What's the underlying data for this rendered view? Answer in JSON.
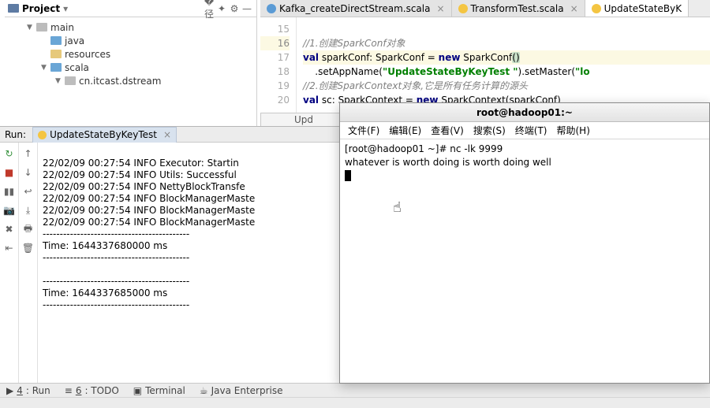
{
  "project": {
    "title": "Project",
    "tree": {
      "main": "main",
      "java": "java",
      "resources": "resources",
      "scala": "scala",
      "pkg": "cn.itcast.dstream"
    }
  },
  "tabs": {
    "t0": "Kafka_createDirectStream.scala",
    "t1": "TransformTest.scala",
    "t2": "UpdateStateByK"
  },
  "code": {
    "c1": "//1.创建SparkConf对象",
    "l2a": "val",
    "l2b": " sparkConf: SparkConf = ",
    "l2c": "new",
    "l2d": " SparkConf",
    "l2e": "()",
    "l3a": "    .setAppName(",
    "l3b": "\"UpdateStateByKeyTest \"",
    "l3c": ").setMaster(",
    "l3d": "\"lo",
    "c2": "//2.创建SparkContext对象,它是所有任务计算的源头",
    "l5a": "val",
    "l5b": " sc: SparkContext = ",
    "l5c": "new",
    "l5d": " SparkContext(sparkConf)",
    "gutter": {
      "n15": "15",
      "n16": "16",
      "n17": "17",
      "n18": "18",
      "n19": "19",
      "n20": "20"
    }
  },
  "breadcrumb": "Upd",
  "run": {
    "label": "Run:",
    "tab": "UpdateStateByKeyTest",
    "lines": {
      "l1": "22/02/09 00:27:54 INFO Executor: Startin",
      "l2": "22/02/09 00:27:54 INFO Utils: Successful",
      "l3": "22/02/09 00:27:54 INFO NettyBlockTransfe",
      "l4": "22/02/09 00:27:54 INFO BlockManagerMaste",
      "l5": "22/02/09 00:27:54 INFO BlockManagerMaste",
      "l6": "22/02/09 00:27:54 INFO BlockManagerMaste",
      "d1": "-------------------------------------------",
      "t1": "Time: 1644337680000 ms",
      "d2": "-------------------------------------------",
      "blank": "",
      "d3": "-------------------------------------------",
      "t2": "Time: 1644337685000 ms",
      "d4": "-------------------------------------------"
    }
  },
  "bottom": {
    "run": "4: Run",
    "runU": "4",
    "todo": "6: TODO",
    "todoU": "6",
    "terminal": "Terminal",
    "jee": "Java Enterprise"
  },
  "term": {
    "title": "root@hadoop01:~",
    "menu": {
      "file": "文件(F)",
      "edit": "编辑(E)",
      "view": "查看(V)",
      "search": "搜索(S)",
      "terminal": "终端(T)",
      "help": "帮助(H)"
    },
    "line1": "[root@hadoop01 ~]# nc -lk 9999",
    "line2": "whatever is worth doing is worth doing well"
  }
}
